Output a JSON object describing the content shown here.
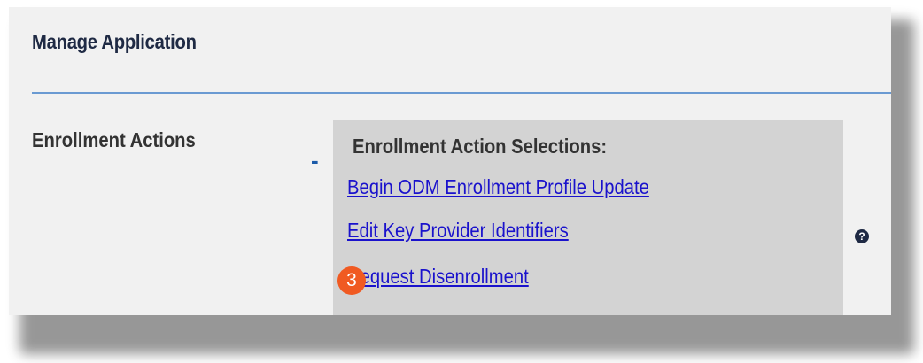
{
  "header": {
    "title": "Manage Application"
  },
  "enrollment": {
    "row_label": "Enrollment Actions",
    "toggle_symbol": "-",
    "selections_heading": "Enrollment Action Selections:",
    "links": [
      {
        "label": "Begin ODM Enrollment Profile Update"
      },
      {
        "label": "Edit Key Provider Identifiers"
      },
      {
        "label": "Request Disenrollment"
      }
    ]
  },
  "annotation": {
    "step_number": "3"
  },
  "help": {
    "icon": "question-circle-icon",
    "glyph": "?"
  },
  "colors": {
    "link": "#1a12cc",
    "divider": "#6a9ad2",
    "step_badge": "#f05a22",
    "selection_box": "#d3d3d3",
    "panel": "#f1f1f1"
  }
}
